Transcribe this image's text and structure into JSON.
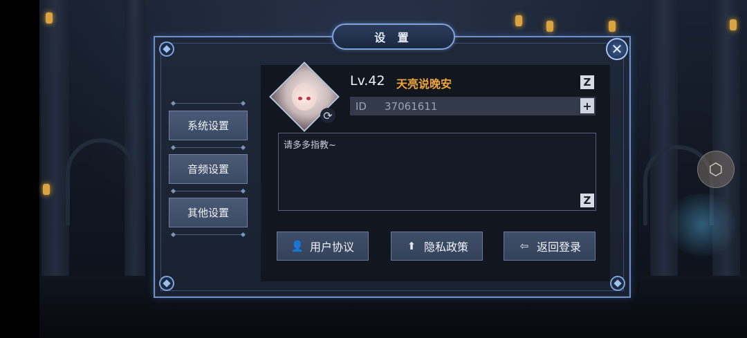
{
  "dialog": {
    "title": "设 置",
    "close_icon": "close-icon"
  },
  "sidebar": {
    "items": [
      {
        "label": "系统设置"
      },
      {
        "label": "音频设置"
      },
      {
        "label": "其他设置"
      }
    ]
  },
  "profile": {
    "level": "Lv.42",
    "nickname": "天亮说晚安",
    "id_label": "ID",
    "id_value": "37061611",
    "signature": "请多多指教~",
    "nickname_color": "#f0a53a"
  },
  "actions": {
    "user_agreement": "用户协议",
    "privacy_policy": "隐私政策",
    "back_to_login": "返回登录"
  },
  "icons": {
    "edit": "Z",
    "copy": "+",
    "refresh": "⟳",
    "user": "👤",
    "privacy": "⬆",
    "logout": "⇦",
    "cube": "⬡"
  }
}
